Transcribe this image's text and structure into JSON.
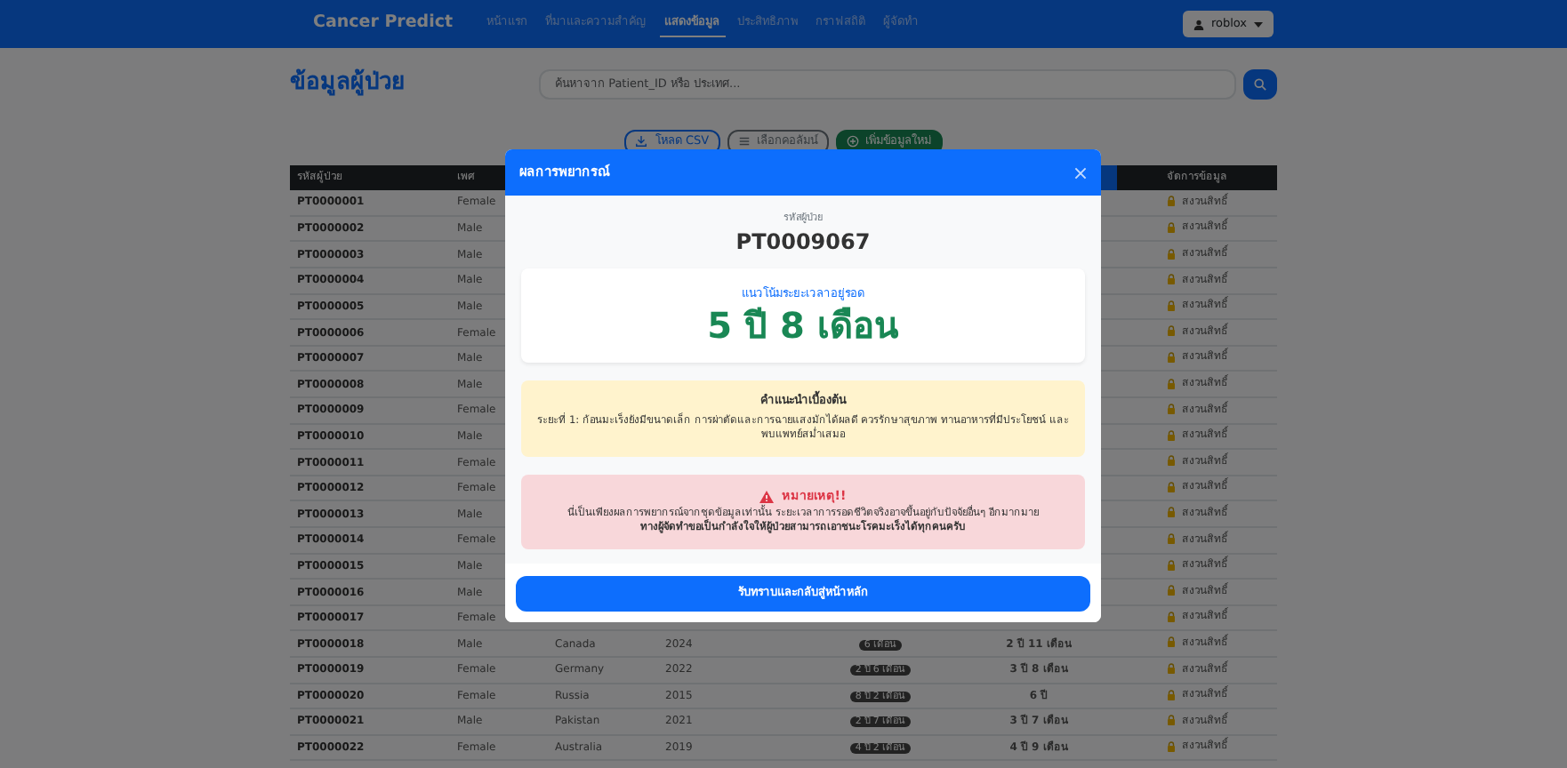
{
  "navbar": {
    "brand": "Cancer Predict",
    "links": [
      {
        "label": "หน้าแรก",
        "selected": false
      },
      {
        "label": "ที่มาและความสำคัญ",
        "selected": false
      },
      {
        "label": "แสดงข้อมูล",
        "selected": true
      },
      {
        "label": "ประสิทธิภาพ",
        "selected": false
      },
      {
        "label": "กราฟสถิติ",
        "selected": false
      },
      {
        "label": "ผู้จัดทำ",
        "selected": false
      }
    ],
    "user": "roblox"
  },
  "page": {
    "title": "ข้อมูลผู้ป่วย",
    "search_placeholder": "ค้นหาจาก Patient_ID หรือ ประเทศ...",
    "buttons": [
      {
        "label": "โหลด CSV",
        "kind": "download"
      },
      {
        "label": "เลือกคอลัมน์",
        "kind": "columns"
      },
      {
        "label": "เพิ่มข้อมูลใหม่",
        "kind": "add"
      }
    ]
  },
  "table": {
    "columns": {
      "id": "รหัสผู้ป่วย",
      "gender": "เพศ",
      "action": "จัดการข้อมูล"
    },
    "rows": [
      {
        "id": "PT0000001",
        "gender": "Female",
        "action": "สงวนสิทธิ์"
      },
      {
        "id": "PT0000002",
        "gender": "Male",
        "action": "สงวนสิทธิ์"
      },
      {
        "id": "PT0000003",
        "gender": "Male",
        "action": "สงวนสิทธิ์"
      },
      {
        "id": "PT0000004",
        "gender": "Male",
        "action": "สงวนสิทธิ์"
      },
      {
        "id": "PT0000005",
        "gender": "Male",
        "action": "สงวนสิทธิ์"
      },
      {
        "id": "PT0000006",
        "gender": "Female",
        "action": "สงวนสิทธิ์"
      },
      {
        "id": "PT0000007",
        "gender": "Male",
        "action": "สงวนสิทธิ์"
      },
      {
        "id": "PT0000008",
        "gender": "Male",
        "action": "สงวนสิทธิ์"
      },
      {
        "id": "PT0000009",
        "gender": "Female",
        "action": "สงวนสิทธิ์"
      },
      {
        "id": "PT0000010",
        "gender": "Male",
        "action": "สงวนสิทธิ์"
      },
      {
        "id": "PT0000011",
        "gender": "Female",
        "action": "สงวนสิทธิ์"
      },
      {
        "id": "PT0000012",
        "gender": "Female",
        "action": "สงวนสิทธิ์"
      },
      {
        "id": "PT0000013",
        "gender": "Male",
        "action": "สงวนสิทธิ์"
      },
      {
        "id": "PT0000014",
        "gender": "Female",
        "action": "สงวนสิทธิ์"
      },
      {
        "id": "PT0000015",
        "gender": "Male",
        "action": "สงวนสิทธิ์"
      },
      {
        "id": "PT0000016",
        "gender": "Male",
        "action": "สงวนสิทธิ์"
      },
      {
        "id": "PT0000017",
        "gender": "Female",
        "action": "สงวนสิทธิ์"
      },
      {
        "id": "PT0000018",
        "gender": "Male",
        "country": "Canada",
        "year": "2024",
        "actual": "6 เดือน",
        "predicted": "2 ปี 11 เดือน",
        "action": "สงวนสิทธิ์"
      },
      {
        "id": "PT0000019",
        "gender": "Female",
        "country": "Germany",
        "year": "2022",
        "actual": "2 ปี 6 เดือน",
        "predicted": "3 ปี 8 เดือน",
        "action": "สงวนสิทธิ์"
      },
      {
        "id": "PT0000020",
        "gender": "Female",
        "country": "Russia",
        "year": "2015",
        "actual": "8 ปี 2 เดือน",
        "predicted": "6 ปี",
        "action": "สงวนสิทธิ์"
      },
      {
        "id": "PT0000021",
        "gender": "Male",
        "country": "Pakistan",
        "year": "2021",
        "actual": "2 ปี 7 เดือน",
        "predicted": "3 ปี 7 เดือน",
        "action": "สงวนสิทธิ์"
      },
      {
        "id": "PT0000022",
        "gender": "Female",
        "country": "Australia",
        "year": "2019",
        "actual": "4 ปี 2 เดือน",
        "predicted": "4 ปี 9 เดือน",
        "action": "สงวนสิทธิ์"
      }
    ]
  },
  "modal": {
    "title": "ผลการพยากรณ์",
    "patient_label": "รหัสผู้ป่วย",
    "patient_id": "PT0009067",
    "result_label": "แนวโน้มระยะเวลาอยู่รอด",
    "result": "5 ปี 8 เดือน",
    "advice": {
      "title": "คำแนะนำเบื้องต้น",
      "text": "ระยะที่ 1: ก้อนมะเร็งยังมีขนาดเล็ก การผ่าตัดและการฉายแสงมักได้ผลดี ควรรักษาสุขภาพ ทานอาหารที่มีประโยชน์ และพบแพทย์สม่ำเสมอ"
    },
    "warning": {
      "title": "หมายเหตุ!!",
      "text": "นี่เป็นเพียงผลการพยากรณ์จากชุดข้อมูลเท่านั้น ระยะเวลาการรอดชีวิตจริงอาจขึ้นอยู่กับปัจจัยอื่นๆ อีกมากมาย",
      "bold_text": "ทางผู้จัดทำขอเป็นกำลังใจให้ผู้ป่วยสามารถเอาชนะโรคมะเร็งได้ทุกคนครับ"
    },
    "button": "รับทราบและกลับสู่หน้าหลัก"
  }
}
